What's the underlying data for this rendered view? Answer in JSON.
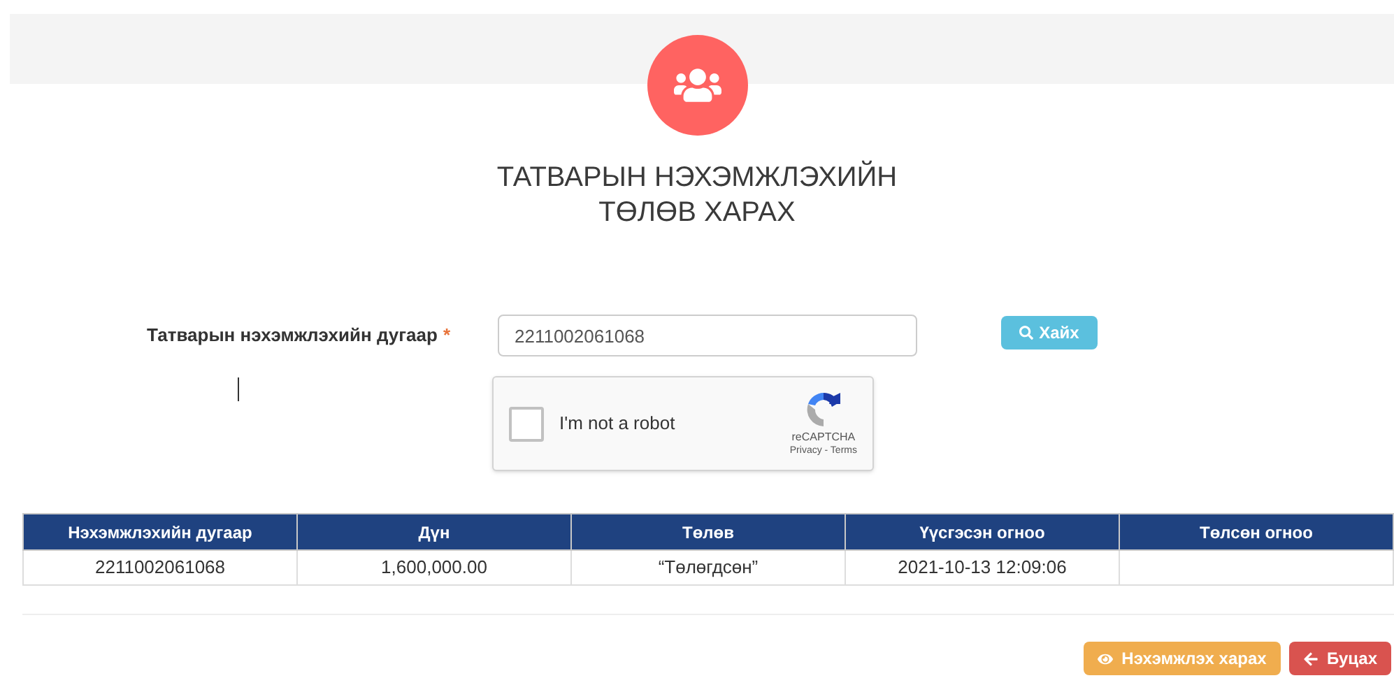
{
  "title": [
    "ТАТВАРЫН НЭХЭМЖЛЭХИЙН",
    "ТӨЛӨВ ХАРАХ"
  ],
  "form": {
    "label": "Татварын нэхэмжлэхийн дугаар",
    "required_mark": "*",
    "value": "2211002061068",
    "search_button": "Хайх"
  },
  "captcha": {
    "checked": false,
    "label": "I'm not a robot",
    "brand": "reCAPTCHA",
    "links": "Privacy - Terms"
  },
  "table": {
    "columns": [
      "Нэхэмжлэхийн дугаар",
      "Дүн",
      "Төлөв",
      "Үүсгэсэн огноо",
      "Төлсөн огноо"
    ],
    "rows": [
      [
        "2211002061068",
        "1,600,000.00",
        "“Төлөгдсөн”",
        "2021-10-13 12:09:06"
      ]
    ]
  },
  "buttons": [
    {
      "kind": "view",
      "label": "Нэхэмжлэх харах"
    },
    {
      "kind": "back",
      "label": "Буцах"
    }
  ]
}
